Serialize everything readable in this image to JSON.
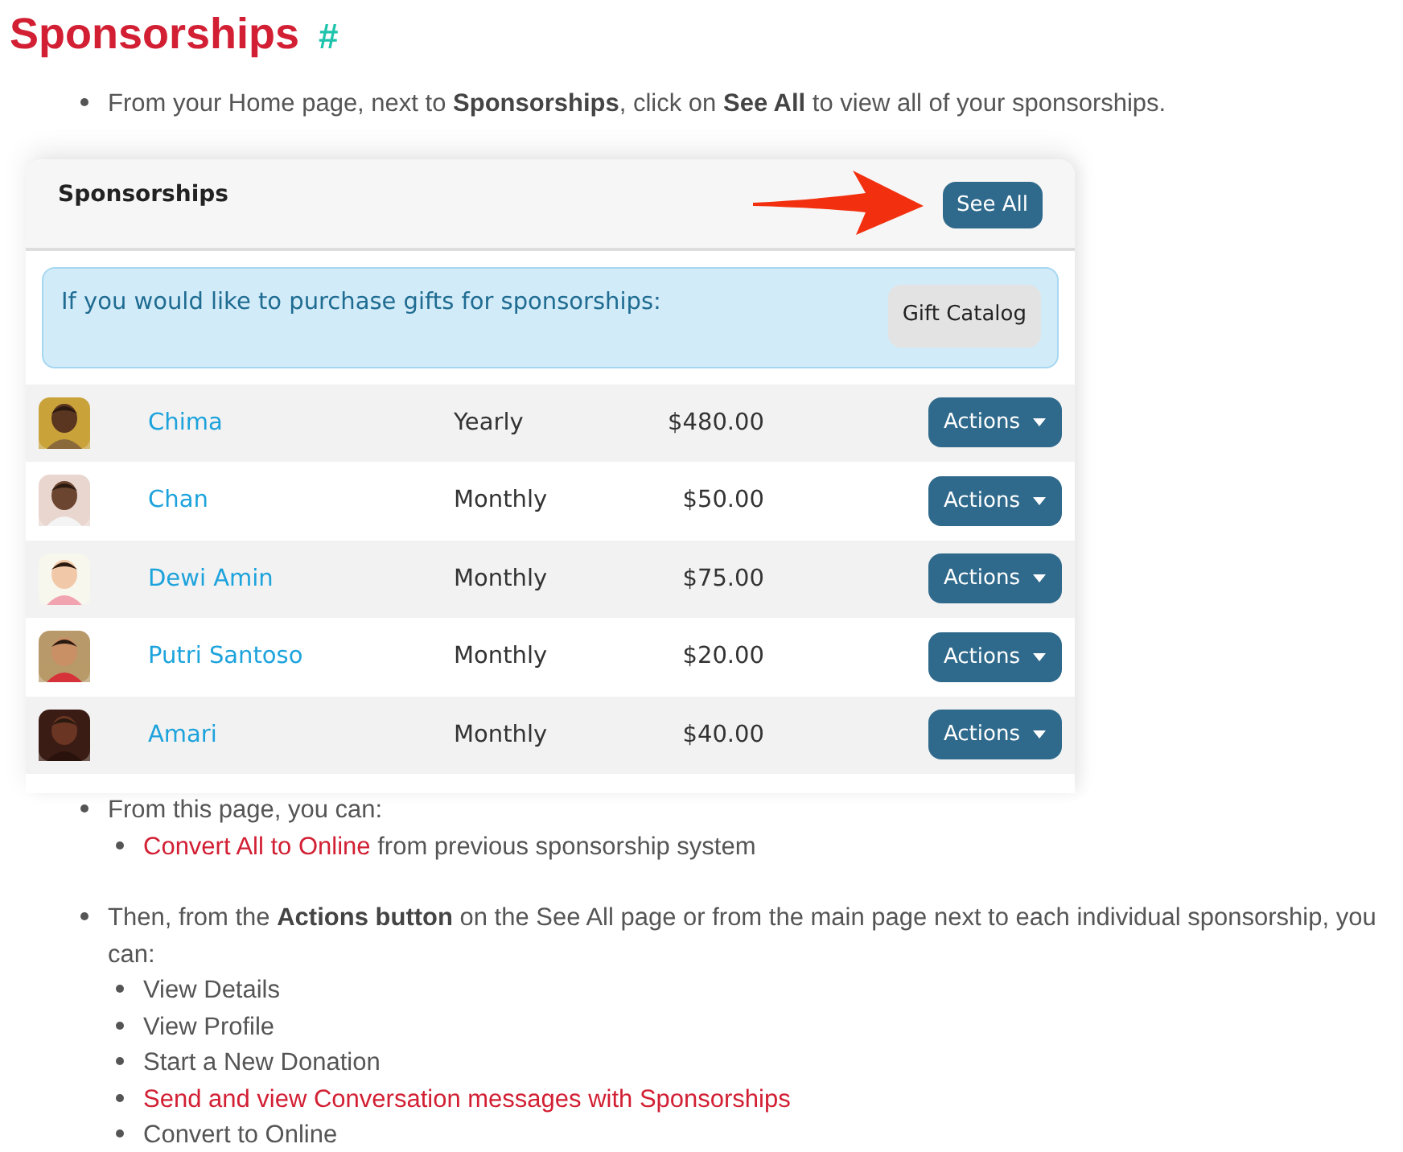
{
  "title": "Sponsorships",
  "anchor": "#",
  "intro": "From your Home page, next to **Sponsorships**, click on **See All** to view all of your sponsorships.",
  "card": {
    "title": "Sponsorships",
    "see_all": "See All",
    "alert": "If you would like to purchase gifts for sponsorships:",
    "gift_button": "Gift Catalog",
    "rows": [
      {
        "name": "Chima",
        "frequency": "Yearly",
        "amount": "$480.00",
        "action": "Actions"
      },
      {
        "name": "Chan",
        "frequency": "Monthly",
        "amount": "$50.00",
        "action": "Actions"
      },
      {
        "name": "Dewi Amin",
        "frequency": "Monthly",
        "amount": "$75.00",
        "action": "Actions"
      },
      {
        "name": "Putri Santoso",
        "frequency": "Monthly",
        "amount": "$20.00",
        "action": "Actions"
      },
      {
        "name": "Amari",
        "frequency": "Monthly",
        "amount": "$40.00",
        "action": "Actions"
      }
    ]
  },
  "sections": [
    {
      "text": "From this page, you can:",
      "items": [
        {
          "link": "Convert All to Online",
          "text": "from previous sponsorship system"
        }
      ]
    },
    {
      "text": "Then, from the **Actions button** on the See All page or from the main page next to each individual sponsorship, you can:",
      "items": [
        {
          "text": "View Details"
        },
        {
          "text": "View Profile"
        },
        {
          "text": "Start a New Donation"
        },
        {
          "link": "Send and view Conversation messages with Sponsorships"
        },
        {
          "text": "Convert to Online"
        }
      ]
    }
  ]
}
